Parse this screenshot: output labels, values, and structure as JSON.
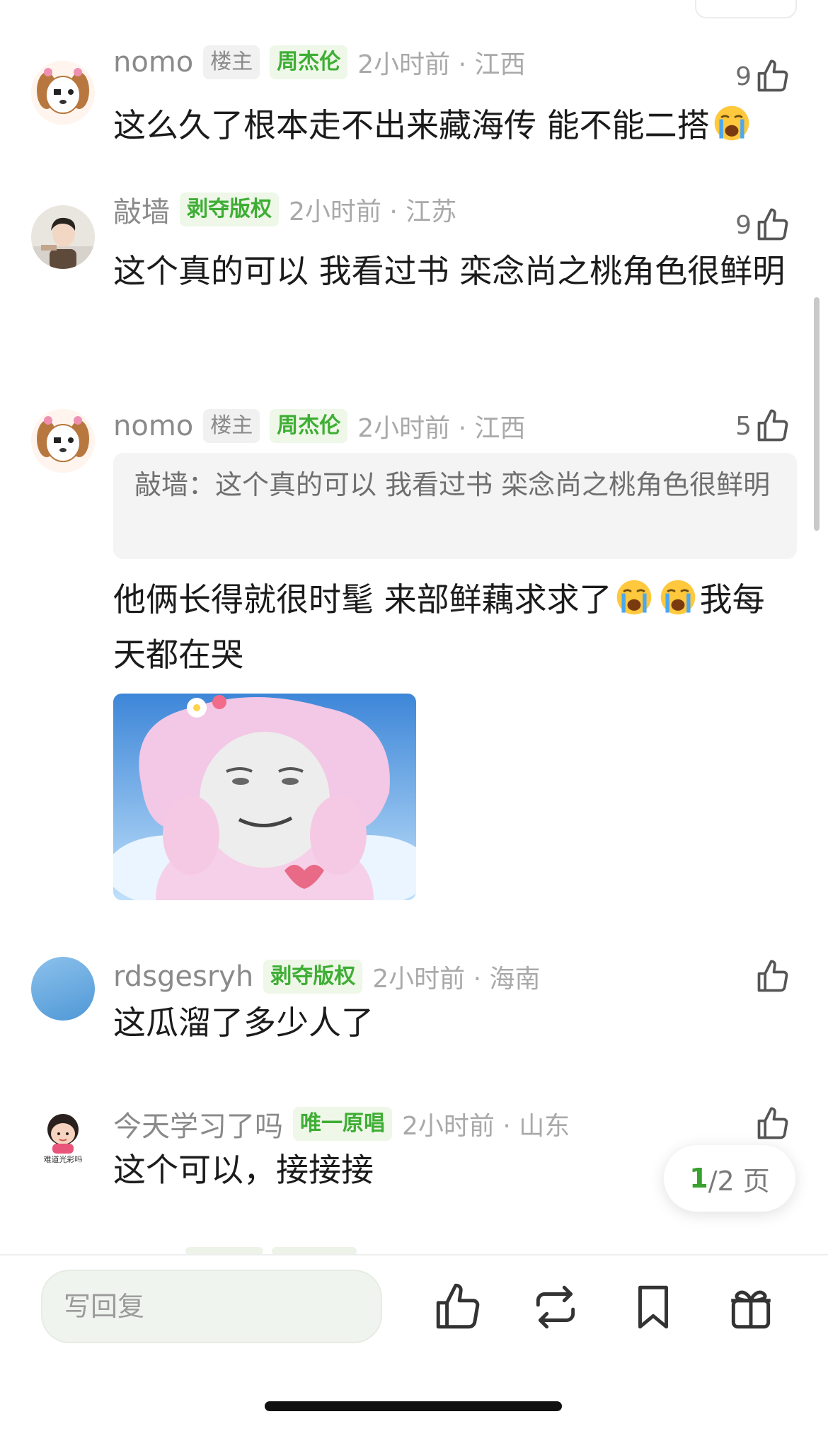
{
  "comments": [
    {
      "username": "nomo",
      "host_badge": "楼主",
      "badge": "周杰伦",
      "time": "2小时前 · 江西",
      "likes": "9",
      "text": "这么久了根本走不出来藏海传 能不能二搭"
    },
    {
      "username": "敲墙",
      "badge": "剥夺版权",
      "time": "2小时前 · 江苏",
      "likes": "9",
      "text": "这个真的可以 我看过书 栾念尚之桃角色很鲜明"
    },
    {
      "username": "nomo",
      "host_badge": "楼主",
      "badge": "周杰伦",
      "time": "2小时前 · 江西",
      "likes": "5",
      "quote": "敲墙：这个真的可以 我看过书 栾念尚之桃角色很鲜明",
      "text_a": "他俩长得就很时髦 来部鲜藕求求了",
      "text_b": "我每天都在哭"
    },
    {
      "username": "rdsgesryh",
      "badge": "剥夺版权",
      "time": "2小时前 · 海南",
      "likes": "",
      "text": "这瓜溜了多少人了"
    },
    {
      "username": "今天学习了吗",
      "badge": "唯一原唱",
      "time": "2小时前 · 山东",
      "likes": "",
      "text": "这个可以，接接接",
      "avatar_caption": "难道光彩吗"
    }
  ],
  "pager": {
    "current": "1",
    "total": "/2 页"
  },
  "bottom_bar": {
    "reply_placeholder": "写回复"
  },
  "icons": [
    "thumbs-up-icon",
    "repost-icon",
    "bookmark-icon",
    "gift-icon",
    "crying-emoji-icon"
  ],
  "colors": {
    "badge_green": "#3eae34",
    "pager_current": "#39a12e"
  }
}
